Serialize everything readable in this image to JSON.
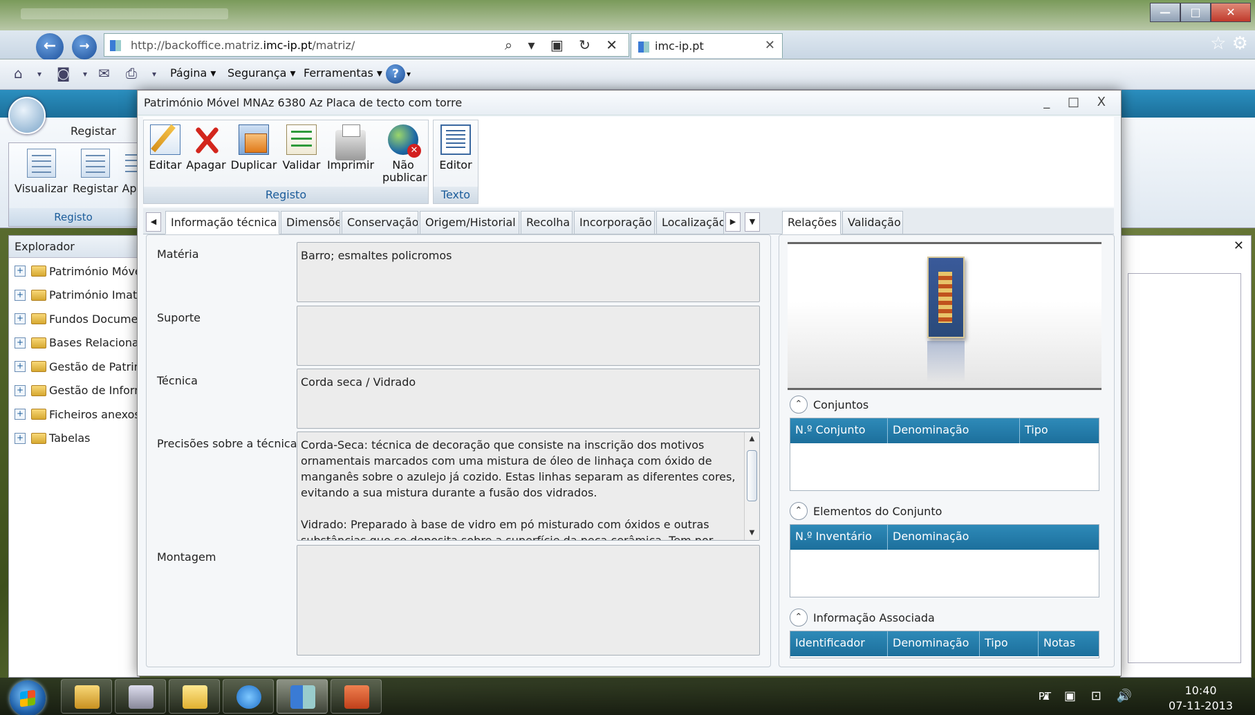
{
  "browser": {
    "url_prefix": "http://backoffice.matriz.",
    "url_domain": "imc-ip.pt",
    "url_suffix": "/matriz/",
    "tab_title": "imc-ip.pt",
    "address_icons": "⌕ ▾ ▣ ↻ ✕",
    "tab_close": "✕",
    "right_icons": "☆ ⚙",
    "window_controls": [
      "—",
      "□",
      "✕"
    ],
    "nav_back": "←",
    "nav_forward": "→",
    "command_bar": {
      "page": "Página ▾",
      "security": "Segurança ▾",
      "tools": "Ferramentas ▾",
      "help": "?",
      "help_arrow": "▾",
      "icons": [
        "⌂",
        "▾",
        "◙",
        "▾",
        "✉",
        "⎙",
        "▾"
      ]
    }
  },
  "background_app": {
    "tab_label": "Registar",
    "ribbon_buttons": [
      "Visualizar",
      "Registar",
      "Ap"
    ],
    "ribbon_group": "Registo",
    "explorer": {
      "title": "Explorador",
      "items": [
        "Património Móvel",
        "Património Imaterial",
        "Fundos Documentais",
        "Bases Relacionais",
        "Gestão de Património",
        "Gestão de Informação",
        "Ficheiros anexos",
        "Tabelas"
      ],
      "expand_glyph": "+"
    },
    "right_panel_close": "✕"
  },
  "dialog": {
    "title": "Património Móvel MNAz 6380 Az Placa de tecto com torre",
    "controls": "_ □ X",
    "ribbon": {
      "registo": {
        "label": "Registo",
        "buttons": [
          {
            "label": "Editar",
            "icon": "edit-icon"
          },
          {
            "label": "Apagar",
            "icon": "delete-icon"
          },
          {
            "label": "Duplicar",
            "icon": "duplicate-icon"
          },
          {
            "label": "Validar",
            "icon": "validate-icon"
          },
          {
            "label": "Imprimir",
            "icon": "print-icon"
          },
          {
            "label": "Não publicar",
            "icon": "unpublish-icon"
          }
        ]
      },
      "texto": {
        "label": "Texto",
        "buttons": [
          {
            "label": "Editor",
            "icon": "text-editor-icon"
          }
        ]
      }
    },
    "tabs_left": {
      "scroll_left": "◀",
      "scroll_right": "▶",
      "dropdown": "▼",
      "items": [
        "Informação técnica",
        "Dimensões",
        "Conservação",
        "Origem/Historial",
        "Recolha",
        "Incorporação",
        "Localização"
      ],
      "active": "Informação técnica"
    },
    "tabs_right": {
      "items": [
        "Relações",
        "Validação"
      ],
      "active": "Relações"
    },
    "form": {
      "materia_label": "Matéria",
      "materia_value": "Barro; esmaltes policromos",
      "suporte_label": "Suporte",
      "suporte_value": "",
      "tecnica_label": "Técnica",
      "tecnica_value": "Corda seca / Vidrado",
      "precisoes_label": "Precisões sobre a técnica",
      "precisoes_p1": "Corda-Seca: técnica de decoração que consiste na inscrição dos motivos ornamentais marcados com uma mistura de óleo de linhaça com óxido de manganês sobre o azulejo já cozido. Estas linhas separam as diferentes cores, evitando a sua mistura durante a fusão dos vidrados.",
      "precisoes_p2": "Vidrado: Preparado à base de vidro em pó misturado com óxidos e outras substâncias que se deposita sobre a superfície da peça cerâmica. Tem por finalidade",
      "scroll_up": "▲",
      "scroll_down": "▼",
      "montagem_label": "Montagem",
      "montagem_value": ""
    },
    "relations": {
      "conjuntos": {
        "title": "Conjuntos",
        "toggle": "⌃",
        "columns": [
          "N.º Conjunto",
          "Denominação",
          "Tipo"
        ]
      },
      "elementos": {
        "title": "Elementos do Conjunto",
        "toggle": "⌃",
        "columns": [
          "N.º Inventário",
          "Denominação"
        ]
      },
      "informacao": {
        "title": "Informação Associada",
        "toggle": "⌃",
        "columns": [
          "Identificador",
          "Denominação",
          "Tipo",
          "Notas"
        ]
      }
    }
  },
  "taskbar": {
    "language": "PT",
    "tray_icons": "▴ ▣ ⊡ 🔊",
    "time": "10:40",
    "date": "07-11-2013"
  }
}
